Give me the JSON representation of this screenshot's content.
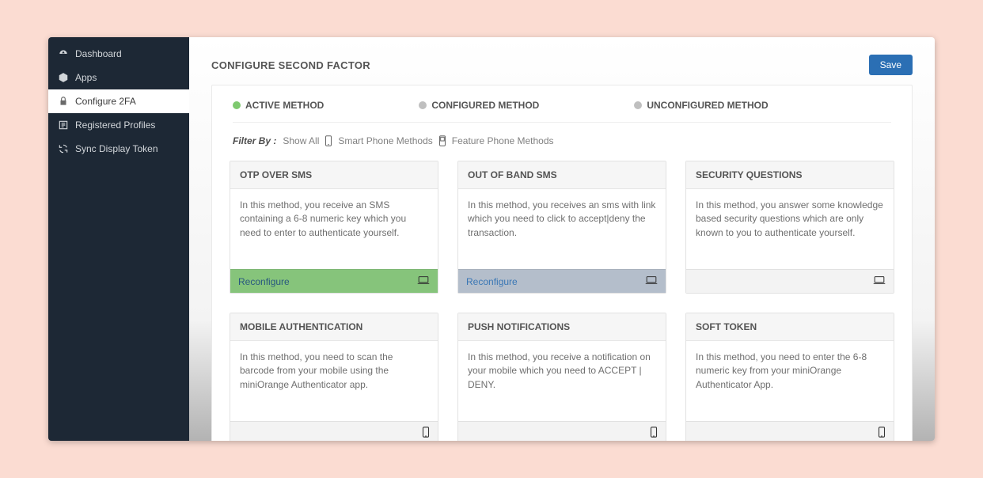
{
  "sidebar": {
    "items": [
      {
        "label": "Dashboard"
      },
      {
        "label": "Apps"
      },
      {
        "label": "Configure 2FA"
      },
      {
        "label": "Registered Profiles"
      },
      {
        "label": "Sync Display Token"
      }
    ]
  },
  "page": {
    "title": "CONFIGURE SECOND FACTOR",
    "save": "Save"
  },
  "legend": {
    "active": "ACTIVE METHOD",
    "configured": "CONFIGURED METHOD",
    "unconfigured": "UNCONFIGURED METHOD"
  },
  "filter": {
    "label": "Filter By :",
    "show_all": "Show All",
    "smart": "Smart Phone Methods",
    "feature": "Feature Phone Methods"
  },
  "cards": [
    {
      "title": "OTP OVER SMS",
      "desc": "In this method, you receive an SMS containing a 6-8 numeric key which you need to enter to authenticate yourself.",
      "action": "Reconfigure",
      "device": "laptop",
      "footer": "green"
    },
    {
      "title": "OUT OF BAND SMS",
      "desc": "In this method, you receives an sms with link which you need to click to accept|deny the transaction.",
      "action": "Reconfigure",
      "device": "laptop",
      "footer": "grey"
    },
    {
      "title": "SECURITY QUESTIONS",
      "desc": "In this method, you answer some knowledge based security questions which are only known to you to authenticate yourself.",
      "action": "",
      "device": "laptop",
      "footer": "white"
    },
    {
      "title": "MOBILE AUTHENTICATION",
      "desc": "In this method, you need to scan the barcode from your mobile using the miniOrange Authenticator app.",
      "action": "",
      "device": "phone",
      "footer": "white"
    },
    {
      "title": "PUSH NOTIFICATIONS",
      "desc": "In this method, you receive a notification on your mobile which you need to ACCEPT | DENY.",
      "action": "",
      "device": "phone",
      "footer": "white"
    },
    {
      "title": "SOFT TOKEN",
      "desc": "In this method, you need to enter the 6-8 numeric key from your miniOrange Authenticator App.",
      "action": "",
      "device": "phone",
      "footer": "white"
    }
  ]
}
